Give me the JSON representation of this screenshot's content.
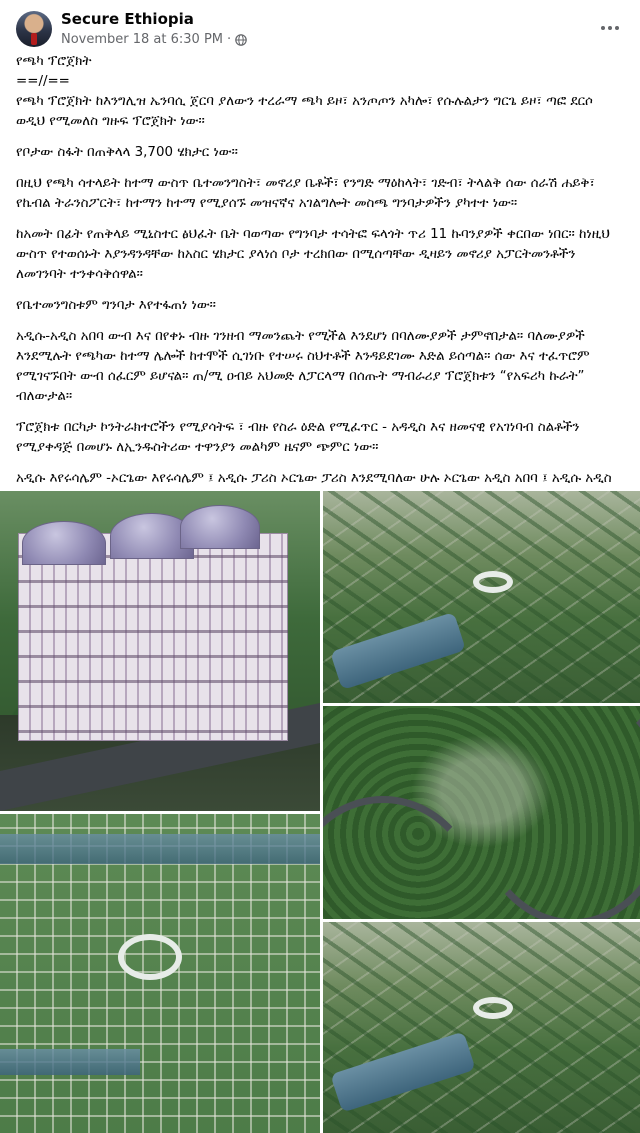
{
  "post": {
    "author": "Secure Ethiopia",
    "timestamp": "November 18 at 6:30 PM",
    "separator": "·",
    "icons": {
      "avatar": "profile-photo",
      "audience": "globe-icon",
      "more": "more-options-icon"
    }
  },
  "text": {
    "title": "የጫካ ፕሮጀክት",
    "divider": "==//==",
    "p1": "የጫካ ፕሮጀክት ከእንግሊዝ ኤንባሲ ጀርባ ያለውን ተረራማ ጫካ ይዞ፣ አንጦጦን አካሎ፣ የሱሉልታን ግርጌ ይዞ፣ ጣፎ ደርሶ ወዲህ የሚመለስ ግዙፍ ፕሮጀክት ነው።",
    "p2": "የቦታው ስፋት በጠቅላላ 3,700 ሄክታር ነው።",
    "p3": "በዚህ የጫካ ሳተላይት ከተማ ውስጥ ቤተመንግስት፣ መኖሪያ ቤቶች፣ የንግድ ማዕከላት፣ ገድብ፣ ትላልቅ ሰው ሰራሽ ሐይቅ፣ የኬብል ትራንስፖርት፣ ከተማን ከተማ የሚያሰኙ መዝናኛና አገልግሎት መስጫ ግንባታዎችን ያካተተ ነው።",
    "p4": "ከአመት በፊት የጠቅላይ ሚኒስተር ፅህፈት ቤት ባወጣው የግንባታ ተሳትፎ ፍላጎት ጥሪ 11 ኩባንያዎች ቀርበው ነበር። ከነዚህ ውስጥ የተወሰኑት እያንዳንዳቸው ከአስር ሄክታር ያላነሰ ቦታ ተረክበው በሚሰጣቸው ዲዛይን መኖሪያ አፓርትመንቶችን ለመገንባት ተንቀሳቅሰዋል።",
    "p5": "የቤተመንግስቱም ግንባታ እየተፋጠነ ነው።",
    "p6": "አዲሱ-አዲስ አበባ ውብ እና በየቀኑ ብዙ ገንዘብ ማመንጨት የሚችል እንደሆነ በባለሙያዎች ታምኖበታል። ባለሙያዎች እንደሚሉት የጫካው ከተማ ሌሎች ከተሞች ሲገነቡ የተሠሩ ስህተቶች እንዳይደገሙ እድል ይሰጣል። ሰው እና ተፈጥሮም የሚገናኙበት ውብ ሰፈርም ይሆናል። ጠ/ሚ ዐብይ አህመድ ለፓርላማ በሰጡት ማብራሪያ ፕሮጀክቱን “የአፍሪካ ኩራት” ብለውታል።",
    "p7": "ፕሮጀክቱ በርካታ ኮንትራክተሮችን የሚያሳትፍ ፣ ብዙ የስራ ዕድል የሚፈጥር - አዳዲስ እና ዘመናዊ የአገነባብ ስልቶችን የሚያቀዳጅ በመሆኑ ለኢንዱስትሪው ተዋንያን መልካም ዜናም ጭምር ነው።",
    "p8": "አዲሱ እየሩሳሌም -ኦርጌው እየሩሳሌም ፤ አዲሱ ፓሪስ ኦርጌው ፓሪስ እንደሚባለው ሁሉ ኦርጌው አዲስ አበባ ፤ አዲሱ አዲስ አበባ - ይባል ዘንድ ጊዜው ፈቅዷል።"
  },
  "photos": [
    {
      "subject": "domed-palace-building"
    },
    {
      "subject": "aerial-green-city-plan"
    },
    {
      "subject": "forest-winding-road"
    },
    {
      "subject": "site-plan-top-view"
    },
    {
      "subject": "aerial-green-city-plan"
    }
  ]
}
